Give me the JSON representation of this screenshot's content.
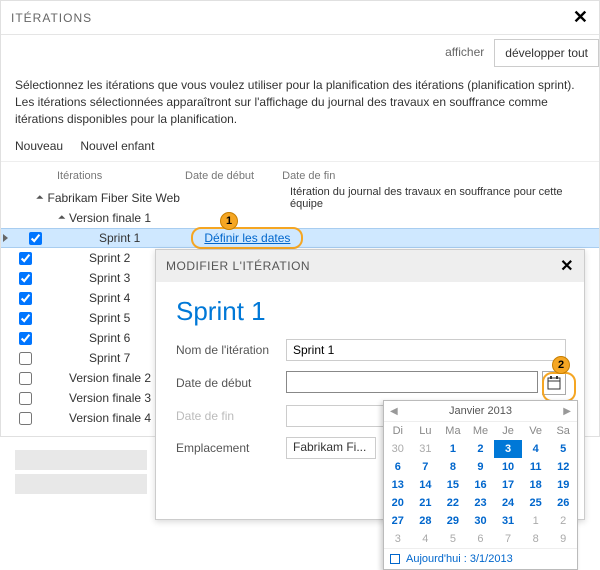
{
  "header": {
    "title": "ITÉRATIONS"
  },
  "toolbar": {
    "afficher": "afficher",
    "expand": "développer tout"
  },
  "description": "Sélectionnez les itérations que vous voulez utiliser pour la planification des itérations (planification sprint). Les itérations sélectionnées apparaîtront sur l'affichage du journal des travaux en souffrance comme itérations disponibles pour la planification.",
  "actions": {
    "new": "Nouveau",
    "newChild": "Nouvel enfant"
  },
  "columns": {
    "iterations": "Itérations",
    "start": "Date de début",
    "end": "Date de fin"
  },
  "tree": {
    "root": {
      "label": "Fabrikam Fiber Site Web",
      "note": "Itération du journal des travaux en souffrance pour cette équipe"
    },
    "v1": "Version finale 1",
    "sprints": [
      "Sprint 1",
      "Sprint 2",
      "Sprint 3",
      "Sprint 4",
      "Sprint 5",
      "Sprint 6",
      "Sprint 7"
    ],
    "v2": "Version finale 2",
    "v3": "Version finale 3",
    "v4": "Version finale 4",
    "defineDates": "Définir les dates"
  },
  "annotations": {
    "1": "1",
    "2": "2"
  },
  "panel": {
    "header": "MODIFIER L'ITÉRATION",
    "title": "Sprint 1",
    "labels": {
      "name": "Nom de l'itération",
      "start": "Date de début",
      "end": "Date de fin",
      "location": "Emplacement"
    },
    "values": {
      "name": "Sprint 1",
      "start": "",
      "end": "",
      "location": "Fabrikam Fi..."
    }
  },
  "calendar": {
    "month": "Janvier 2013",
    "dow": [
      "Di",
      "Lu",
      "Ma",
      "Me",
      "Je",
      "Ve",
      "Sa"
    ],
    "days": [
      {
        "n": "30",
        "o": true
      },
      {
        "n": "31",
        "o": true
      },
      {
        "n": "1"
      },
      {
        "n": "2"
      },
      {
        "n": "3",
        "sel": true
      },
      {
        "n": "4"
      },
      {
        "n": "5"
      },
      {
        "n": "6"
      },
      {
        "n": "7"
      },
      {
        "n": "8"
      },
      {
        "n": "9"
      },
      {
        "n": "10"
      },
      {
        "n": "11"
      },
      {
        "n": "12"
      },
      {
        "n": "13"
      },
      {
        "n": "14"
      },
      {
        "n": "15"
      },
      {
        "n": "16"
      },
      {
        "n": "17"
      },
      {
        "n": "18"
      },
      {
        "n": "19"
      },
      {
        "n": "20"
      },
      {
        "n": "21"
      },
      {
        "n": "22"
      },
      {
        "n": "23"
      },
      {
        "n": "24"
      },
      {
        "n": "25"
      },
      {
        "n": "26"
      },
      {
        "n": "27"
      },
      {
        "n": "28"
      },
      {
        "n": "29"
      },
      {
        "n": "30"
      },
      {
        "n": "31"
      },
      {
        "n": "1",
        "o": true
      },
      {
        "n": "2",
        "o": true
      },
      {
        "n": "3",
        "o": true
      },
      {
        "n": "4",
        "o": true
      },
      {
        "n": "5",
        "o": true
      },
      {
        "n": "6",
        "o": true
      },
      {
        "n": "7",
        "o": true
      },
      {
        "n": "8",
        "o": true
      },
      {
        "n": "9",
        "o": true
      }
    ],
    "today": "Aujourd'hui : 3/1/2013"
  }
}
